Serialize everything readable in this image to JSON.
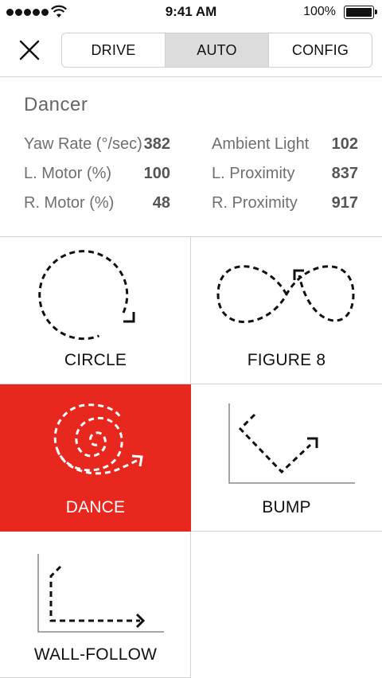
{
  "status_bar": {
    "time": "9:41 AM",
    "battery_percent": "100%",
    "signal_bars": 5,
    "icons": [
      "signal-icon",
      "wifi-icon",
      "battery-icon"
    ]
  },
  "nav": {
    "close_icon": "close-icon",
    "tabs": [
      {
        "label": "DRIVE",
        "selected": false
      },
      {
        "label": "AUTO",
        "selected": true
      },
      {
        "label": "CONFIG",
        "selected": false
      }
    ]
  },
  "robot": {
    "name": "Dancer",
    "stats_left": [
      {
        "label": "Yaw Rate (°/sec)",
        "value": "382"
      },
      {
        "label": "L. Motor (%)",
        "value": "100"
      },
      {
        "label": "R. Motor (%)",
        "value": "48"
      }
    ],
    "stats_right": [
      {
        "label": "Ambient Light",
        "value": "102"
      },
      {
        "label": "L. Proximity",
        "value": "837"
      },
      {
        "label": "R. Proximity",
        "value": "917"
      }
    ]
  },
  "modes": [
    {
      "label": "CIRCLE",
      "icon": "circle-path-icon",
      "active": false
    },
    {
      "label": "FIGURE 8",
      "icon": "figure-eight-path-icon",
      "active": false
    },
    {
      "label": "DANCE",
      "icon": "spiral-path-icon",
      "active": true
    },
    {
      "label": "BUMP",
      "icon": "bump-path-icon",
      "active": false
    },
    {
      "label": "WALL-FOLLOW",
      "icon": "wall-follow-path-icon",
      "active": false
    }
  ],
  "colors": {
    "accent": "#e8281e",
    "segment_selected": "#dcdcdc",
    "divider": "#d4d4d4"
  }
}
